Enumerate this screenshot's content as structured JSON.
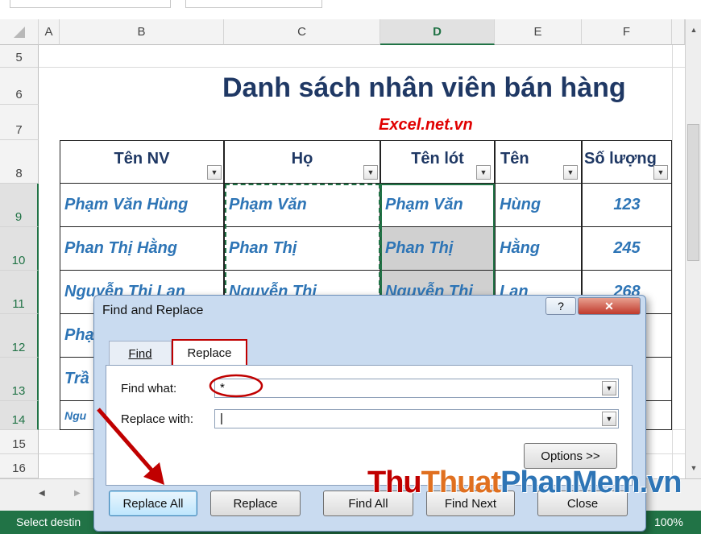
{
  "columns": [
    "A",
    "B",
    "C",
    "D",
    "E",
    "F"
  ],
  "rows": [
    "5",
    "6",
    "7",
    "8",
    "9",
    "10",
    "11",
    "12",
    "13",
    "14",
    "15",
    "16"
  ],
  "sheet_title": "Danh sách nhân viên bán hàng",
  "site": "Excel.net.vn",
  "headers": [
    "Tên NV",
    "Họ",
    "Tên lót",
    "Tên",
    "Số lượng"
  ],
  "data_rows": [
    {
      "name": "Phạm Văn Hùng",
      "ho": "Phạm Văn",
      "tenlot": "Phạm Văn",
      "ten": "Hùng",
      "qty": "123"
    },
    {
      "name": "Phan Thị Hằng",
      "ho": "Phan Thị",
      "tenlot": "Phan Thị",
      "ten": "Hằng",
      "qty": "245"
    },
    {
      "name": "Nguyễn Thị Lan",
      "ho": "Nguyễn Thị",
      "tenlot": "Nguyễn Thị",
      "ten": "Lan",
      "qty": "268"
    },
    {
      "name": "Phạ",
      "ho": "",
      "tenlot": "",
      "ten": "",
      "qty": ""
    },
    {
      "name": "Trầ",
      "ho": "",
      "tenlot": "",
      "ten": "",
      "qty": ""
    },
    {
      "name": "Ngu",
      "ho": "",
      "tenlot": "",
      "ten": "",
      "qty": ""
    }
  ],
  "status_text": "Select destin",
  "zoom": "100%",
  "dialog": {
    "title": "Find and Replace",
    "help": "?",
    "close_x": "✕",
    "tab_find": "Find",
    "tab_replace": "Replace",
    "find_label": "Find what:",
    "find_value": "*",
    "replace_label": "Replace with:",
    "replace_value": "|",
    "options": "Options >>",
    "replace_all": "Replace All",
    "replace": "Replace",
    "find_all": "Find All",
    "find_next": "Find Next",
    "close": "Close"
  },
  "watermark": {
    "part1": "Thu",
    "part2": "Thuat",
    "part3": "Phan",
    "part4": "Mem",
    "part5": ".vn"
  },
  "colors": {
    "excel_green": "#217346",
    "annotation_red": "#c00000"
  }
}
